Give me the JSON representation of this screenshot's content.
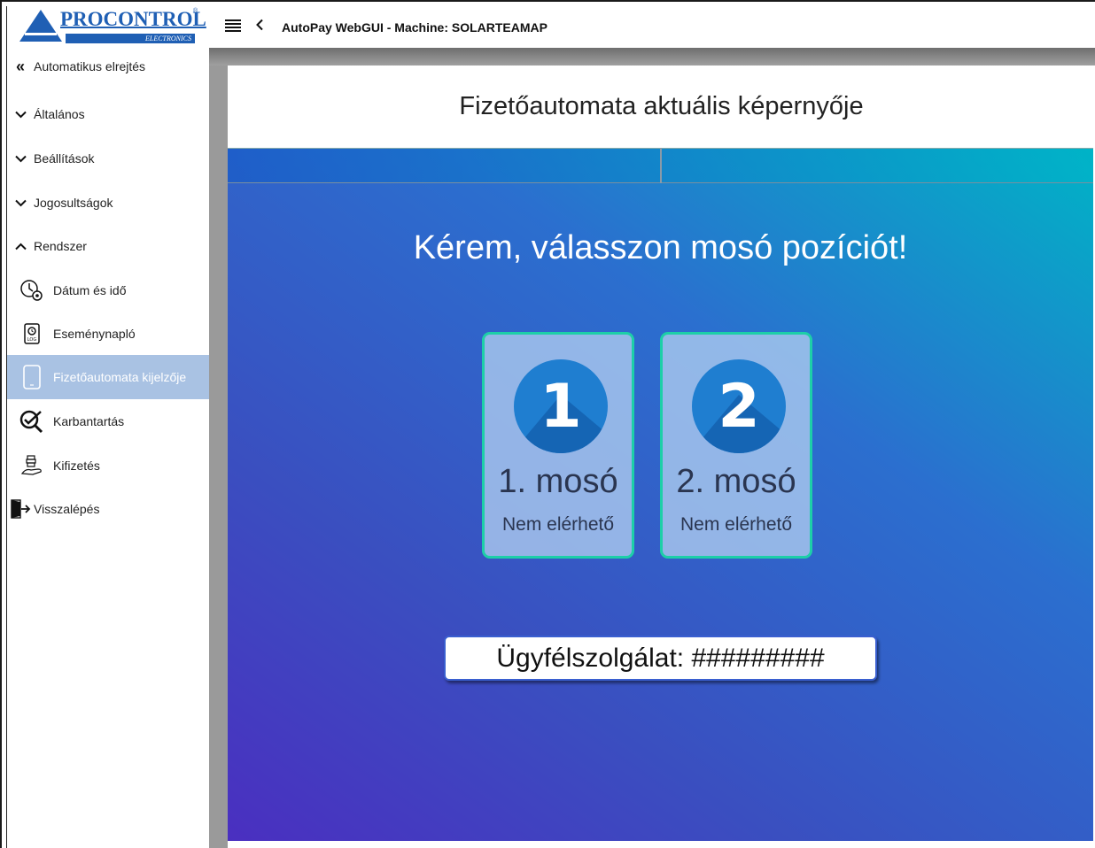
{
  "brand": {
    "name": "PROCONTROL",
    "subtitle": "ELECTRONICS"
  },
  "topbar": {
    "title": "AutoPay WebGUI - Machine: SOLARTEAMAP"
  },
  "sidebar": {
    "items": [
      {
        "label": "Automatikus elrejtés",
        "icon": "double-chevron-left-icon"
      },
      {
        "label": "Általános",
        "icon": "chevron-down-icon"
      },
      {
        "label": "Beállítások",
        "icon": "chevron-down-icon"
      },
      {
        "label": "Jogosultságok",
        "icon": "chevron-down-icon"
      },
      {
        "label": "Rendszer",
        "icon": "chevron-up-icon"
      },
      {
        "label": "Dátum és idő",
        "icon": "clock-gear-icon"
      },
      {
        "label": "Eseménynapló",
        "icon": "log-file-icon"
      },
      {
        "label": "Fizetőautomata kijelzője",
        "icon": "tablet-icon",
        "active": true
      },
      {
        "label": "Karbantartás",
        "icon": "maintenance-check-icon"
      },
      {
        "label": "Kifizetés",
        "icon": "payout-hand-icon"
      },
      {
        "label": "Visszalépés",
        "icon": "logout-icon"
      }
    ]
  },
  "panel": {
    "title": "Fizetőautomata aktuális képernyője"
  },
  "screen": {
    "prompt": "Kérem, válasszon mosó pozíciót!",
    "cards": [
      {
        "number": "1",
        "name": "1. mosó",
        "status": "Nem elérhető"
      },
      {
        "number": "2",
        "name": "2. mosó",
        "status": "Nem elérhető"
      }
    ],
    "service": "Ügyfélszolgálat: #########"
  },
  "colors": {
    "accent": "#1f5fb4",
    "active_nav": "#a9c2e3",
    "card_border": "#1dcfa8",
    "circle": "#1f7ed0"
  }
}
